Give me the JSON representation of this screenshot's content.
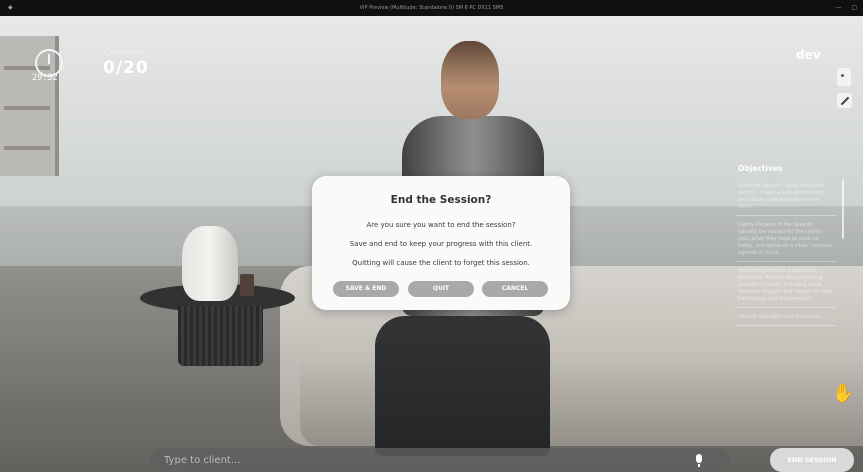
{
  "window": {
    "title": "VIP Preview (Multitude: Standalone 0) SM 6 PC DX11 SM5"
  },
  "hud": {
    "timer": "29:32",
    "questions_label": "Questions",
    "questions_count": "0/20",
    "user": "dev"
  },
  "objectives": {
    "title": "Objectives",
    "items": [
      "Establish Rapport: Greet the client warmly, create a safe environment and clarify confidentiality and its limits.",
      "Clarify Purpose of the Session: Identify the reason for the client's visit, what they hope to work on today, and agree on a clear, concrete agenda or focus.",
      "Presenting Problem Exploration: Examples: Explore the presenting problem in detail, including onset, duration, triggers and impact on daily functioning and relationships.",
      "Identify Strengths and Resources."
    ]
  },
  "chat": {
    "placeholder": "Type to client..."
  },
  "end_session_label": "END SESSION",
  "dialog": {
    "title": "End the Session?",
    "line1": "Are you sure you want to end the session?",
    "line2": "Save and end to keep your progress with this client.",
    "line3": "Quitting will cause the client to forget this session.",
    "save_label": "SAVE & END",
    "quit_label": "QUIT",
    "cancel_label": "CANCEL"
  },
  "colors": {
    "dialog_bg": "#fafafa",
    "button_gray": "#a9a9a9",
    "end_button": "#d8d8d8"
  }
}
